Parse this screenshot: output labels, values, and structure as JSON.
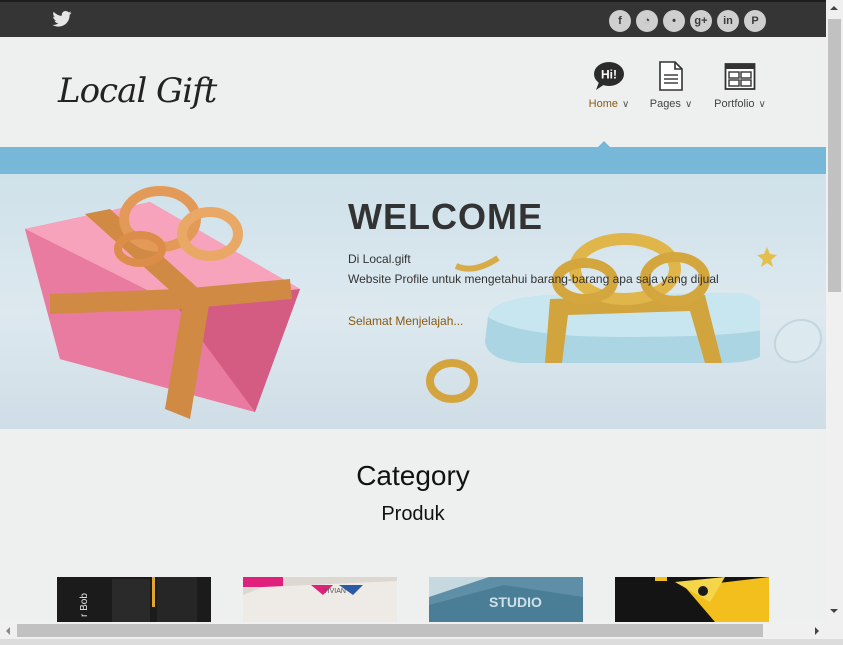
{
  "topbar": {
    "twitter_icon": "twitter-icon",
    "social": [
      {
        "name": "facebook-icon",
        "glyph": "f"
      },
      {
        "name": "rss-icon",
        "glyph": "◔"
      },
      {
        "name": "twitter-icon",
        "glyph": "•"
      },
      {
        "name": "googleplus-icon",
        "glyph": "g+"
      },
      {
        "name": "linkedin-icon",
        "glyph": "in"
      },
      {
        "name": "pinterest-icon",
        "glyph": "P"
      }
    ]
  },
  "header": {
    "logo": "Local Gift",
    "nav": [
      {
        "label": "Home",
        "icon": "speech-bubble-icon",
        "icon_text": "Hi!"
      },
      {
        "label": "Pages",
        "icon": "document-icon"
      },
      {
        "label": "Portfolio",
        "icon": "portfolio-grid-icon"
      }
    ]
  },
  "hero": {
    "title": "WELCOME",
    "line1": "Di Local.gift",
    "line2": "Website Profile untuk mengetahui barang-barang apa saja yang dijual",
    "link": "Selamat Menjelajah..."
  },
  "section": {
    "title": "Category",
    "subtitle": "Produk"
  },
  "thumbnails": [
    {
      "name": "product-thumb-1",
      "text": "r Bob"
    },
    {
      "name": "product-thumb-2",
      "text": "YIVIAN"
    },
    {
      "name": "product-thumb-3",
      "text": "STUDIO"
    },
    {
      "name": "product-thumb-4",
      "text": ""
    }
  ],
  "colors": {
    "topbar": "#353535",
    "accent": "#8a5a10",
    "bluebar": "#77b8d9",
    "background": "#eef0f0"
  }
}
